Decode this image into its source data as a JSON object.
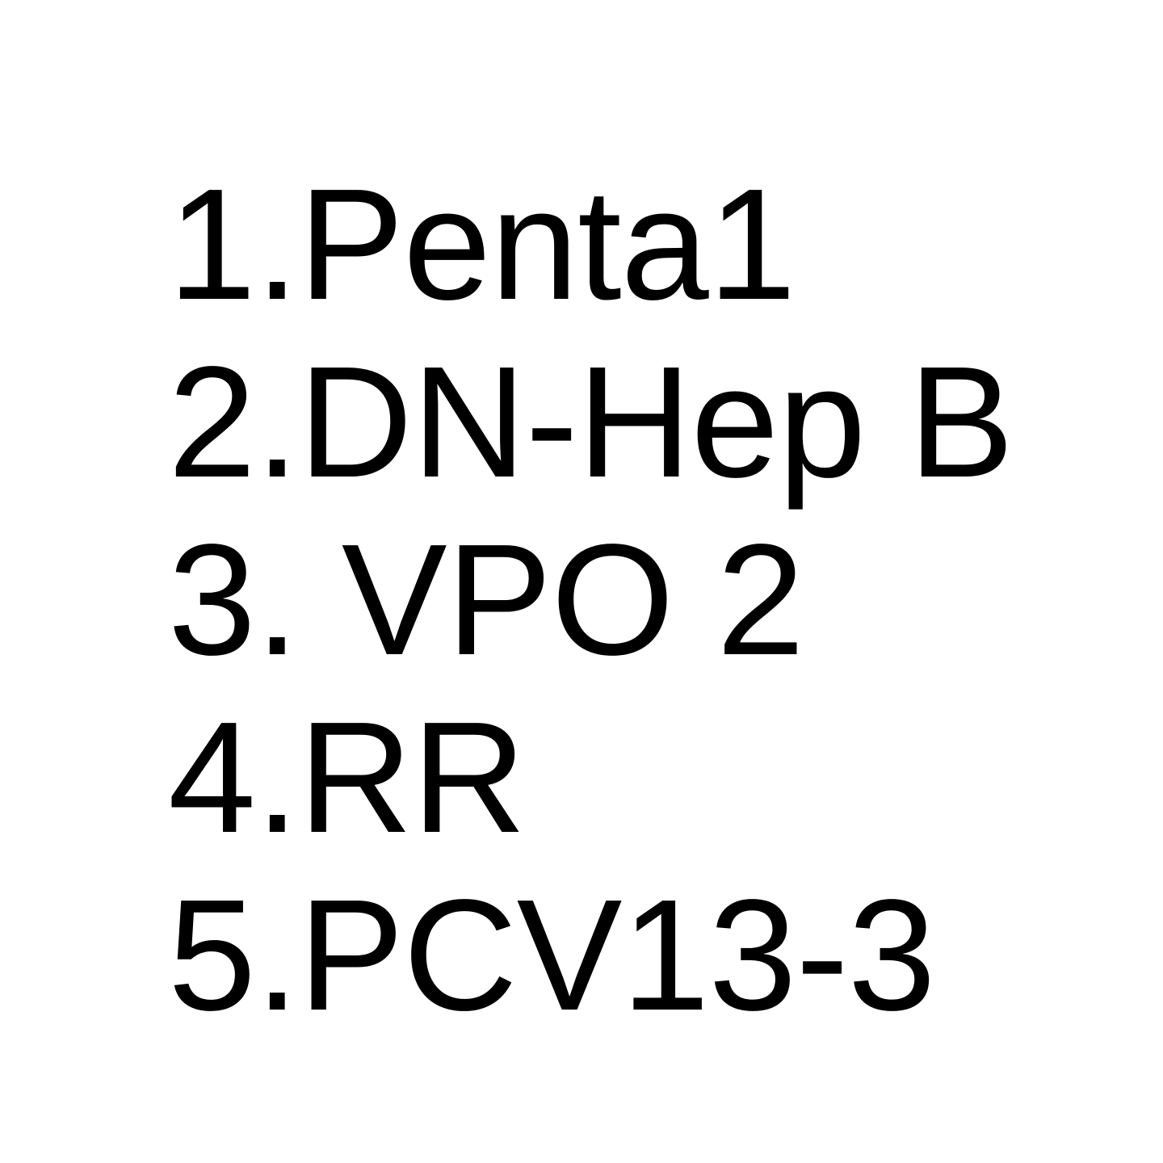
{
  "items": [
    "1.Penta1",
    "2.DN-Hep B",
    "3. VPO 2",
    "4.RR",
    "5.PCV13-3"
  ],
  "colors": {
    "background": "#ffffff",
    "text": "#000000"
  }
}
